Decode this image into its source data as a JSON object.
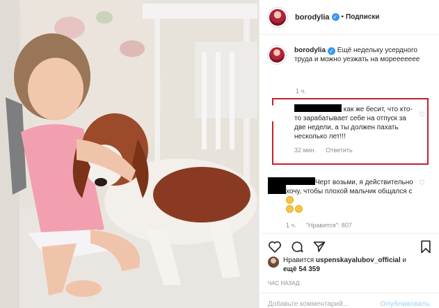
{
  "post": {
    "username": "borodylia",
    "follow_label": "Подписки",
    "dot": "•",
    "caption_text": "Ещё недельку усердного труда и можно уезжать на мореееееее",
    "caption_time": "1 ч.",
    "comments": [
      {
        "text": "как же бесит, что кто-то зарабатывает себе на отпуск за две недели, а ты должен пахать несколько лет!!!",
        "time": "32 мин.",
        "reply_label": "Ответить"
      },
      {
        "text": "Черт возьми, я действительно хочу, чтобы плохой мальчик общался с",
        "time": "1 ч.",
        "likes_label": "\"Нравится\": 807"
      }
    ],
    "likes_prefix": "Нравится",
    "likes_user": "uspenskayalubov_official",
    "likes_and": "и",
    "likes_count": "ещё 54 359",
    "time_ago": "час назад",
    "add_comment_placeholder": "Добавьте комментарий...",
    "publish_label": "Опубликовать"
  },
  "colors": {
    "verified": "#3897f0",
    "highlight_box": "#c41f2f",
    "muted": "#8e8e8e"
  },
  "icons": [
    "heart-icon",
    "comment-icon",
    "share-icon",
    "bookmark-icon",
    "verified-icon"
  ]
}
